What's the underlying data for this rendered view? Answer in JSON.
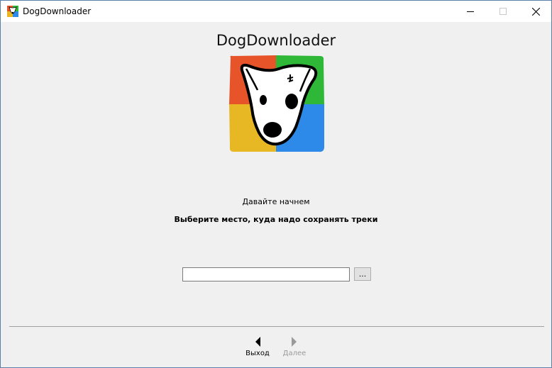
{
  "window": {
    "title": "DogDownloader",
    "controls": {
      "minimize_icon": "minimize-icon",
      "maximize_icon": "maximize-icon",
      "close_icon": "close-icon"
    }
  },
  "main": {
    "heading": "DogDownloader",
    "logo_icon": "dog-logo",
    "intro_text": "Давайте начнем",
    "instruction_text": "Выберите место, куда надо сохранять треки",
    "path_input": {
      "value": "",
      "placeholder": ""
    },
    "browse_label": "..."
  },
  "navigation": {
    "back_label": "Выход",
    "next_label": "Далее",
    "next_enabled": false
  },
  "colors": {
    "logo_red": "#e8542a",
    "logo_green": "#2fb838",
    "logo_yellow": "#e7b824",
    "logo_blue": "#2d8ae8",
    "background": "#f0f0f0",
    "disabled_text": "#9a9a9a"
  }
}
